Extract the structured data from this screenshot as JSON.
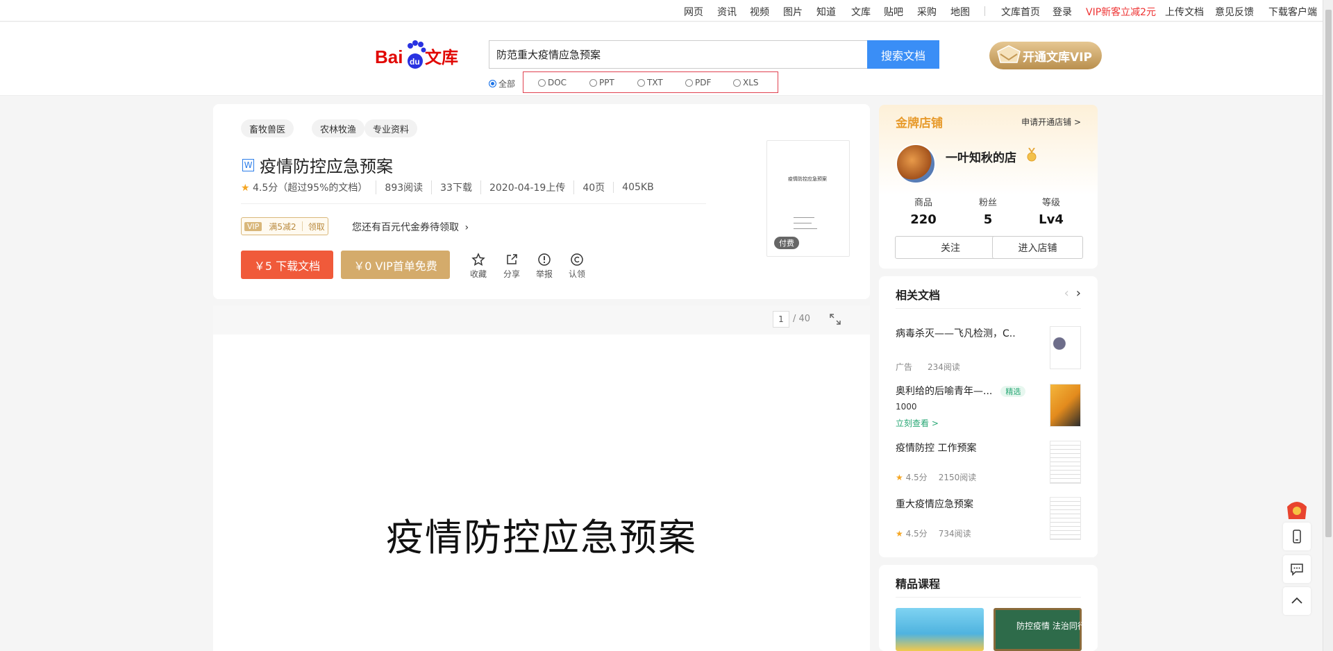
{
  "topnav": {
    "links": [
      "网页",
      "资讯",
      "视频",
      "图片",
      "知道",
      "文库",
      "贴吧",
      "采购",
      "地图"
    ],
    "right": [
      "文库首页",
      "登录",
      "VIP新客立减2元",
      "上传文档",
      "意见反馈",
      "下载客户端"
    ]
  },
  "header": {
    "logo_text": "Bai du 文库",
    "search_value": "防范重大疫情应急预案",
    "search_button": "搜索文档",
    "vip_banner": "开通文库VIP",
    "filetypes": [
      "全部",
      "DOC",
      "PPT",
      "TXT",
      "PDF",
      "XLS"
    ]
  },
  "doc": {
    "tags": [
      "畜牧兽医",
      "农林牧渔",
      "专业资料"
    ],
    "type_icon": "W",
    "title": "疫情防控应急预案",
    "rating": "4.5分（超过95%的文档）",
    "reads": "893阅读",
    "downloads": "33下载",
    "upload_date": "2020-04-19上传",
    "pages": "40页",
    "size": "405KB",
    "coupon": {
      "vip": "VIP",
      "offer": "满5减2",
      "claim": "领取"
    },
    "coupon_hint": "您还有百元代金券待领取",
    "download_btn": "￥5 下载文档",
    "vip_btn": "￥0 VIP首单免费",
    "actions": [
      "收藏",
      "分享",
      "举报",
      "认领"
    ],
    "thumb_title": "疫情防控应急预案",
    "paid_badge": "付费"
  },
  "reader": {
    "current_page": "1",
    "total_pages": "/ 40",
    "page_heading": "疫情防控应急预案"
  },
  "shop": {
    "label": "金牌店铺",
    "apply": "申请开通店铺 >",
    "name": "一叶知秋的店",
    "stats": [
      {
        "label": "商品",
        "value": "220"
      },
      {
        "label": "粉丝",
        "value": "5"
      },
      {
        "label": "等级",
        "value": "Lv4"
      }
    ],
    "follow_btn": "关注",
    "enter_btn": "进入店铺"
  },
  "related": {
    "title": "相关文档",
    "items": [
      {
        "title": "病毒杀灭——飞凡检测，C..",
        "sub1": "广告",
        "sub2": "234阅读"
      },
      {
        "title": "奥利给的后喻青年—...",
        "badge": "精选",
        "sub1": "1000",
        "link": "立刻查看 >"
      },
      {
        "title": "疫情防控 工作预案",
        "rating": "4.5分",
        "sub2": "2150阅读"
      },
      {
        "title": "重大疫情应急预案",
        "rating": "4.5分",
        "sub2": "734阅读"
      }
    ]
  },
  "courses": {
    "title": "精品课程",
    "items": [
      "防控疫情 法治同行"
    ]
  }
}
